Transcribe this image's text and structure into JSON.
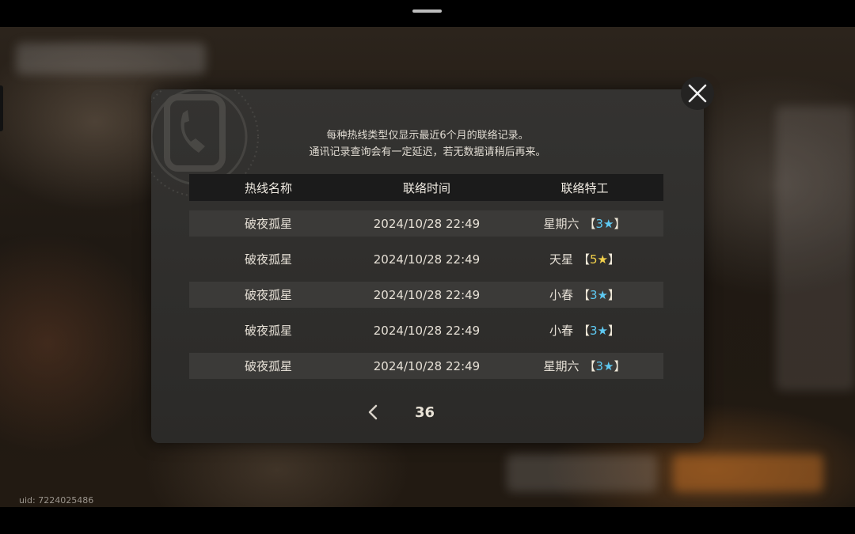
{
  "uid": "uid: 7224025486",
  "notice": {
    "line1": "每种热线类型仅显示最近6个月的联络记录。",
    "line2": "通讯记录查询会有一定延迟，若无数据请稍后再来。"
  },
  "table": {
    "headers": [
      "热线名称",
      "联络时间",
      "联络特工"
    ],
    "rows": [
      {
        "hotline": "破夜孤星",
        "time": "2024/10/28 22:49",
        "agent": "星期六",
        "rank": "3",
        "rank_color": "#5ec9f2"
      },
      {
        "hotline": "破夜孤星",
        "time": "2024/10/28 22:49",
        "agent": "天星",
        "rank": "5",
        "rank_color": "#f2d04a"
      },
      {
        "hotline": "破夜孤星",
        "time": "2024/10/28 22:49",
        "agent": "小春",
        "rank": "3",
        "rank_color": "#5ec9f2"
      },
      {
        "hotline": "破夜孤星",
        "time": "2024/10/28 22:49",
        "agent": "小春",
        "rank": "3",
        "rank_color": "#5ec9f2"
      },
      {
        "hotline": "破夜孤星",
        "time": "2024/10/28 22:49",
        "agent": "星期六",
        "rank": "3",
        "rank_color": "#5ec9f2"
      }
    ]
  },
  "pager": {
    "page": "36",
    "prev_icon": "chevron-left-icon"
  },
  "close_icon": "close-icon",
  "rank_bracket_open": "【",
  "rank_bracket_close": "】"
}
